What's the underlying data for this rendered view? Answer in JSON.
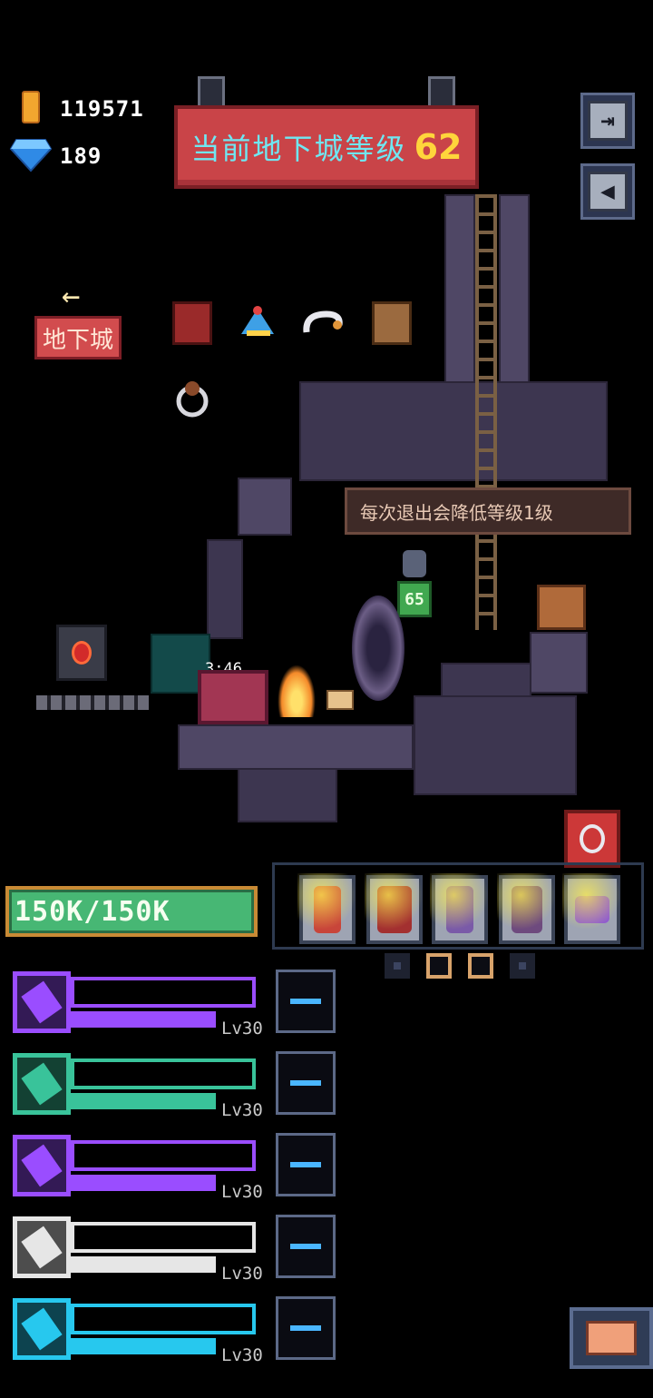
{
  "currency": {
    "gold": "119571",
    "gems": "189"
  },
  "banner": {
    "title": "当前地下城等级",
    "level": "62"
  },
  "nav": {
    "back_arrow": "←",
    "dungeon_label": "地下城"
  },
  "tooltip": "每次退出会降低等级1级",
  "enemy_level": "65",
  "chest_timer": "3:46",
  "hp": "150K/150K",
  "equipment": [
    "bow",
    "axe",
    "bow",
    "shield",
    "hammer"
  ],
  "equipment_slot_dots": [
    "off",
    "on",
    "on",
    "off"
  ],
  "skills": [
    {
      "icon": "arrows-icon",
      "level": "Lv30",
      "color": "#9a4dff"
    },
    {
      "icon": "branch-icon",
      "level": "Lv30",
      "color": "#39c39a"
    },
    {
      "icon": "arrows-icon",
      "level": "Lv30",
      "color": "#9a4dff"
    },
    {
      "icon": "crystal-icon",
      "level": "Lv30",
      "color": "#e6e6e6"
    },
    {
      "icon": "mace-icon",
      "level": "Lv30",
      "color": "#27c8ee"
    }
  ],
  "colors": {
    "banner_red": "#c94448",
    "banner_text": "#6fe7f2",
    "banner_level": "#ffd53b",
    "hp_green": "#47b774",
    "slot_dash": "#4ab6ff"
  }
}
